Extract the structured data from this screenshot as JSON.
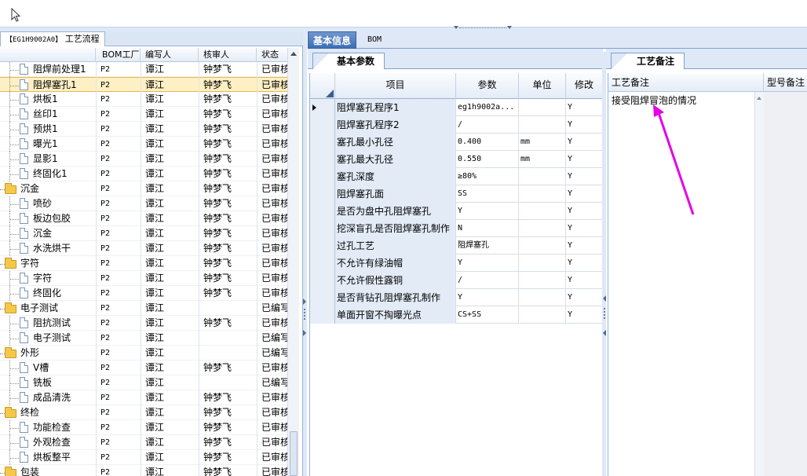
{
  "left_panel": {
    "tab_code": "【EG1H9002A0】",
    "tab_label": "工艺流程",
    "columns": [
      "BOM工厂",
      "编写人",
      "核审人",
      "状态"
    ],
    "rows": [
      {
        "type": "doc",
        "name": "阻焊前处理1",
        "factory": "P2",
        "author": "谭江",
        "reviewer": "钟梦飞",
        "status": "已审核"
      },
      {
        "type": "doc",
        "name": "阻焊塞孔1",
        "factory": "P2",
        "author": "谭江",
        "reviewer": "钟梦飞",
        "status": "已审核",
        "selected": true
      },
      {
        "type": "doc",
        "name": "烘板1",
        "factory": "P2",
        "author": "谭江",
        "reviewer": "钟梦飞",
        "status": "已审核"
      },
      {
        "type": "doc",
        "name": "丝印1",
        "factory": "P2",
        "author": "谭江",
        "reviewer": "钟梦飞",
        "status": "已审核"
      },
      {
        "type": "doc",
        "name": "预烘1",
        "factory": "P2",
        "author": "谭江",
        "reviewer": "钟梦飞",
        "status": "已审核"
      },
      {
        "type": "doc",
        "name": "曝光1",
        "factory": "P2",
        "author": "谭江",
        "reviewer": "钟梦飞",
        "status": "已审核"
      },
      {
        "type": "doc",
        "name": "显影1",
        "factory": "P2",
        "author": "谭江",
        "reviewer": "钟梦飞",
        "status": "已审核"
      },
      {
        "type": "doc",
        "name": "终固化1",
        "factory": "P2",
        "author": "谭江",
        "reviewer": "钟梦飞",
        "status": "已审核"
      },
      {
        "type": "folder",
        "name": "沉金",
        "factory": "P2",
        "author": "谭江",
        "reviewer": "钟梦飞",
        "status": "已审核"
      },
      {
        "type": "doc",
        "name": "喷砂",
        "factory": "P2",
        "author": "谭江",
        "reviewer": "钟梦飞",
        "status": "已审核"
      },
      {
        "type": "doc",
        "name": "板边包胶",
        "factory": "P2",
        "author": "谭江",
        "reviewer": "钟梦飞",
        "status": "已审核"
      },
      {
        "type": "doc",
        "name": "沉金",
        "factory": "P2",
        "author": "谭江",
        "reviewer": "钟梦飞",
        "status": "已审核"
      },
      {
        "type": "doc",
        "name": "水洗烘干",
        "factory": "P2",
        "author": "谭江",
        "reviewer": "钟梦飞",
        "status": "已审核"
      },
      {
        "type": "folder",
        "name": "字符",
        "factory": "P2",
        "author": "谭江",
        "reviewer": "钟梦飞",
        "status": "已审核"
      },
      {
        "type": "doc",
        "name": "字符",
        "factory": "P2",
        "author": "谭江",
        "reviewer": "钟梦飞",
        "status": "已审核"
      },
      {
        "type": "doc",
        "name": "终固化",
        "factory": "P2",
        "author": "谭江",
        "reviewer": "钟梦飞",
        "status": "已审核"
      },
      {
        "type": "folder",
        "name": "电子测试",
        "factory": "P2",
        "author": "谭江",
        "reviewer": "",
        "status": "已编写"
      },
      {
        "type": "doc",
        "name": "阻抗测试",
        "factory": "P2",
        "author": "谭江",
        "reviewer": "钟梦飞",
        "status": "已审核"
      },
      {
        "type": "doc",
        "name": "电子测试",
        "factory": "P2",
        "author": "谭江",
        "reviewer": "",
        "status": "已编写"
      },
      {
        "type": "folder",
        "name": "外形",
        "factory": "P2",
        "author": "谭江",
        "reviewer": "",
        "status": "已编写"
      },
      {
        "type": "doc",
        "name": "V槽",
        "factory": "P2",
        "author": "谭江",
        "reviewer": "钟梦飞",
        "status": "已审核"
      },
      {
        "type": "doc",
        "name": "铣板",
        "factory": "P2",
        "author": "谭江",
        "reviewer": "",
        "status": "已编写"
      },
      {
        "type": "doc",
        "name": "成品清洗",
        "factory": "P2",
        "author": "谭江",
        "reviewer": "钟梦飞",
        "status": "已审核"
      },
      {
        "type": "folder",
        "name": "终检",
        "factory": "P2",
        "author": "谭江",
        "reviewer": "钟梦飞",
        "status": "已审核"
      },
      {
        "type": "doc",
        "name": "功能检查",
        "factory": "P2",
        "author": "谭江",
        "reviewer": "钟梦飞",
        "status": "已审核"
      },
      {
        "type": "doc",
        "name": "外观检查",
        "factory": "P2",
        "author": "谭江",
        "reviewer": "钟梦飞",
        "status": "已审核"
      },
      {
        "type": "doc",
        "name": "烘板整平",
        "factory": "P2",
        "author": "谭江",
        "reviewer": "钟梦飞",
        "status": "已审核"
      },
      {
        "type": "folder",
        "name": "包装",
        "factory": "P2",
        "author": "谭江",
        "reviewer": "钟梦飞",
        "status": "已审核"
      }
    ]
  },
  "main_tabs": {
    "active": "基本信息",
    "other": "BOM"
  },
  "params_panel": {
    "subtab": "基本参数",
    "columns": [
      "项目",
      "参数",
      "单位",
      "修改"
    ],
    "rows": [
      {
        "item": "阻焊塞孔程序1",
        "param": "eg1h9002a...",
        "unit": "",
        "modify": "Y"
      },
      {
        "item": "阻焊塞孔程序2",
        "param": "/",
        "unit": "",
        "modify": "Y"
      },
      {
        "item": "塞孔最小孔径",
        "param": "0.400",
        "unit": "mm",
        "modify": "Y"
      },
      {
        "item": "塞孔最大孔径",
        "param": "0.550",
        "unit": "mm",
        "modify": "Y"
      },
      {
        "item": "塞孔深度",
        "param": "≥80%",
        "unit": "",
        "modify": "Y"
      },
      {
        "item": "阻焊塞孔面",
        "param": "SS",
        "unit": "",
        "modify": "Y"
      },
      {
        "item": "是否为盘中孔阻焊塞孔",
        "param": "Y",
        "unit": "",
        "modify": "Y"
      },
      {
        "item": "挖深盲孔是否阻焊塞孔制作",
        "param": "N",
        "unit": "",
        "modify": "Y"
      },
      {
        "item": "过孔工艺",
        "param": "阻焊塞孔",
        "unit": "",
        "modify": "Y"
      },
      {
        "item": "不允许有绿油帽",
        "param": "Y",
        "unit": "",
        "modify": "Y"
      },
      {
        "item": "不允许假性露铜",
        "param": "/",
        "unit": "",
        "modify": "Y"
      },
      {
        "item": "是否背钻孔阻焊塞孔制作",
        "param": "Y",
        "unit": "",
        "modify": "Y"
      },
      {
        "item": "单面开窗不掏曝光点",
        "param": "CS+SS",
        "unit": "",
        "modify": "Y"
      }
    ]
  },
  "notes_panel": {
    "subtab": "工艺备注",
    "col1": "工艺备注",
    "col2": "型号备注",
    "note_text": "接受阻焊冒泡的情况"
  },
  "colors": {
    "annotation_arrow": "#e600e6",
    "selection": "#fdf0c5"
  }
}
